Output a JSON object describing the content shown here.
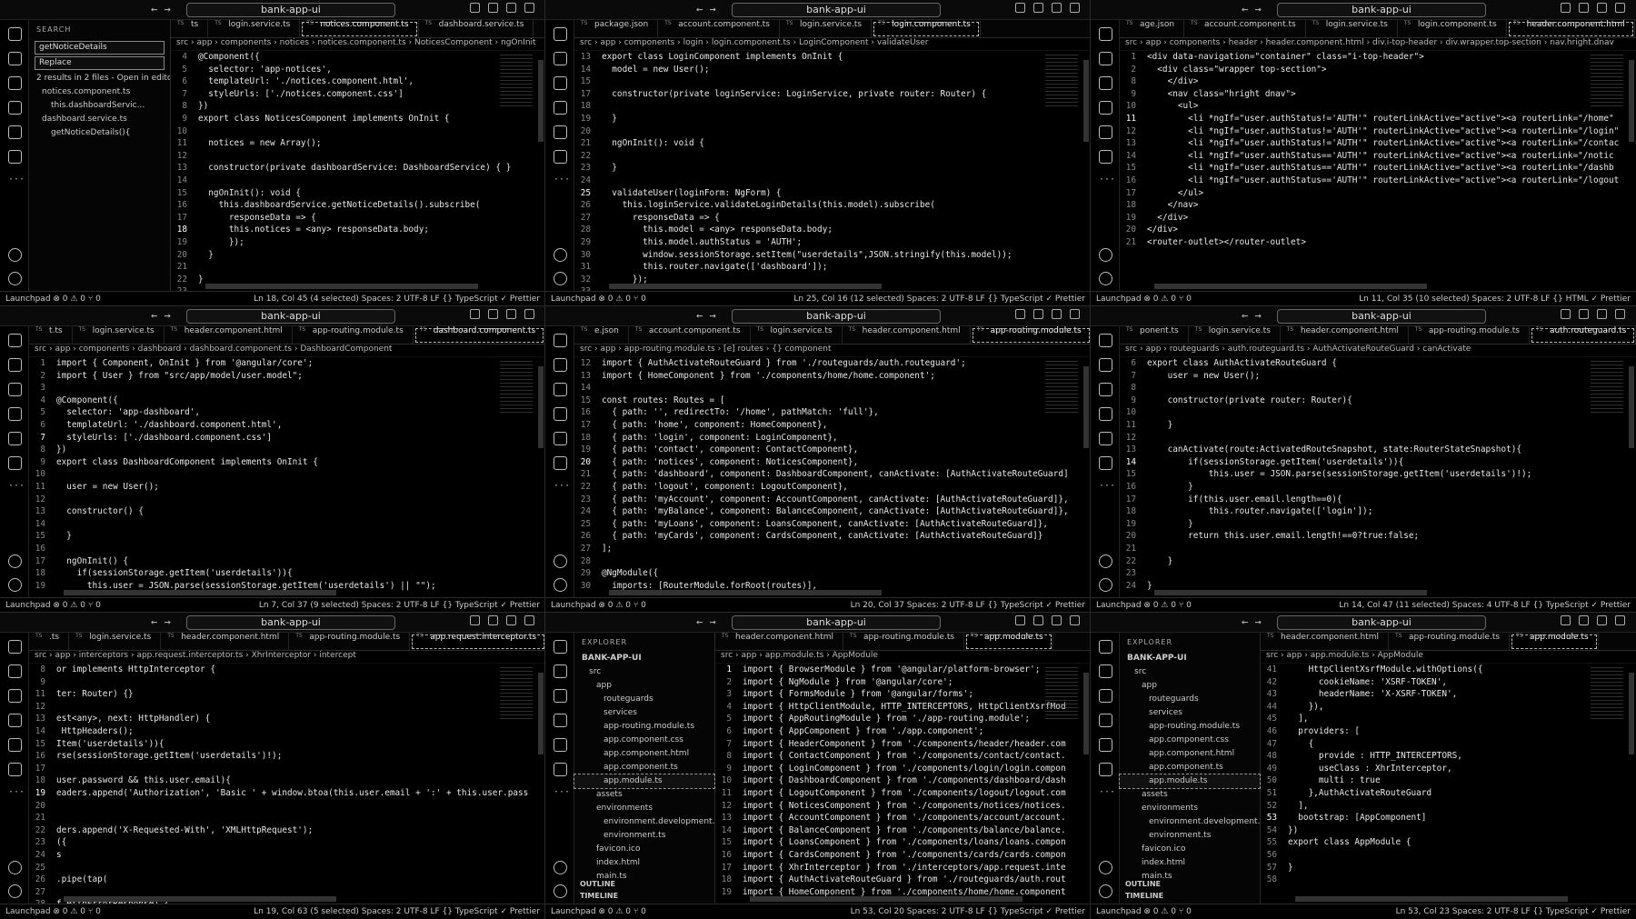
{
  "window_title": "bank-app-ui",
  "nav_arrows": "← →",
  "panes": [
    {
      "sidebar": {
        "type": "search",
        "header": "SEARCH",
        "search_value": "getNoticeDetails",
        "replace_placeholder": "Replace",
        "rows": [
          "2 results in 2 files - Open in editor",
          "notices.component.ts",
          "this.dashboardServic...",
          "dashboard.service.ts",
          "getNoticeDetails(){"
        ]
      },
      "tabs": [
        "ts",
        "login.service.ts",
        "notices.component.ts",
        "dashboard.service.ts"
      ],
      "active_tab": 2,
      "breadcrumb": "src › app › components › notices › notices.component.ts › NoticesComponent › ngOnInit",
      "lines": [
        [
          "4",
          "@Component({"
        ],
        [
          "5",
          "  selector: 'app-notices',"
        ],
        [
          "6",
          "  templateUrl: './notices.component.html',"
        ],
        [
          "7",
          "  styleUrls: ['./notices.component.css']"
        ],
        [
          "8",
          "})"
        ],
        [
          "9",
          "export class NoticesComponent implements OnInit {"
        ],
        [
          "10",
          ""
        ],
        [
          "11",
          "  notices = new Array();"
        ],
        [
          "12",
          ""
        ],
        [
          "13",
          "  constructor(private dashboardService: DashboardService) { }"
        ],
        [
          "14",
          ""
        ],
        [
          "15",
          "  ngOnInit(): void {"
        ],
        [
          "16",
          "    this.dashboardService.getNoticeDetails().subscribe("
        ],
        [
          "17",
          "      responseData => {"
        ],
        [
          "18",
          "      this.notices = <any> responseData.body;"
        ],
        [
          "19",
          "      });"
        ],
        [
          "20",
          "  }"
        ],
        [
          "21",
          ""
        ],
        [
          "22",
          "}"
        ],
        [
          "23",
          ""
        ]
      ],
      "current_line": "18",
      "status_left": "Launchpad  ⊗ 0 ⚠ 0  ⑂ 0",
      "status_right": "Ln 18, Col 45 (4 selected)   Spaces: 2   UTF-8   LF   {} TypeScript   ✓ Prettier"
    },
    {
      "tabs": [
        "package.json",
        "account.component.ts",
        "login.service.ts",
        "login.component.ts"
      ],
      "active_tab": 3,
      "breadcrumb": "src › app › components › login › login.component.ts › LoginComponent › validateUser",
      "lines": [
        [
          "13",
          "export class LoginComponent implements OnInit {"
        ],
        [
          "14",
          "  model = new User();"
        ],
        [
          "15",
          ""
        ],
        [
          "17",
          "  constructor(private loginService: LoginService, private router: Router) {"
        ],
        [
          "18",
          ""
        ],
        [
          "19",
          "  }"
        ],
        [
          "20",
          ""
        ],
        [
          "21",
          "  ngOnInit(): void {"
        ],
        [
          "22",
          ""
        ],
        [
          "23",
          "  }"
        ],
        [
          "24",
          ""
        ],
        [
          "25",
          "  validateUser(loginForm: NgForm) {"
        ],
        [
          "26",
          "    this.loginService.validateLoginDetails(this.model).subscribe("
        ],
        [
          "27",
          "      responseData => {"
        ],
        [
          "28",
          "        this.model = <any> responseData.body;"
        ],
        [
          "29",
          "        this.model.authStatus = 'AUTH';"
        ],
        [
          "30",
          "        window.sessionStorage.setItem(\"userdetails\",JSON.stringify(this.model));"
        ],
        [
          "31",
          "        this.router.navigate(['dashboard']);"
        ],
        [
          "32",
          "      });"
        ],
        [
          "33",
          ""
        ]
      ],
      "current_line": "25",
      "status_left": "Launchpad  ⊗ 0 ⚠ 0  ⑂ 0",
      "status_right": "Ln 25, Col 16 (12 selected)   Spaces: 2   UTF-8   LF   {} TypeScript   ✓ Prettier"
    },
    {
      "tabs": [
        "age.json",
        "account.component.ts",
        "login.service.ts",
        "login.component.ts",
        "header.component.html"
      ],
      "active_tab": 4,
      "breadcrumb": "src › app › components › header › header.component.html › div.i-top-header › div.wrapper.top-section › nav.hright.dnav",
      "lines": [
        [
          "1",
          "<div data-navigation=\"container\" class=\"i-top-header\">"
        ],
        [
          "2",
          "  <div class=\"wrapper top-section\">"
        ],
        [
          "8",
          "    </div>"
        ],
        [
          "9",
          "    <nav class=\"hright dnav\">"
        ],
        [
          "10",
          "      <ul>"
        ],
        [
          "11",
          "        <li *ngIf=\"user.authStatus!='AUTH'\" routerLinkActive=\"active\"><a routerLink=\"/home\""
        ],
        [
          "12",
          "        <li *ngIf=\"user.authStatus!='AUTH'\" routerLinkActive=\"active\"><a routerLink=\"/login\""
        ],
        [
          "13",
          "        <li *ngIf=\"user.authStatus!='AUTH'\" routerLinkActive=\"active\"><a routerLink=\"/contac"
        ],
        [
          "14",
          "        <li *ngIf=\"user.authStatus=='AUTH'\" routerLinkActive=\"active\"><a routerLink=\"/notic"
        ],
        [
          "15",
          "        <li *ngIf=\"user.authStatus=='AUTH'\" routerLinkActive=\"active\"><a routerLink=\"/dashb"
        ],
        [
          "16",
          "        <li *ngIf=\"user.authStatus=='AUTH'\" routerLinkActive=\"active\"><a routerLink=\"/logout"
        ],
        [
          "17",
          "      </ul>"
        ],
        [
          "18",
          "    </nav>"
        ],
        [
          "19",
          "  </div>"
        ],
        [
          "20",
          "</div>"
        ],
        [
          "21",
          "<router-outlet></router-outlet>"
        ]
      ],
      "current_line": "11",
      "status_left": "Launchpad  ⊗ 0 ⚠ 0  ⑂ 0",
      "status_right": "Ln 11, Col 35 (10 selected)   Spaces: 2   UTF-8   LF   {} HTML   ✓ Prettier"
    },
    {
      "tabs": [
        "t.ts",
        "login.service.ts",
        "header.component.html",
        "app-routing.module.ts",
        "dashboard.component.ts"
      ],
      "active_tab": 4,
      "breadcrumb": "src › app › components › dashboard › dashboard.component.ts › DashboardComponent",
      "lines": [
        [
          "1",
          "import { Component, OnInit } from '@angular/core';"
        ],
        [
          "2",
          "import { User } from \"src/app/model/user.model\";"
        ],
        [
          "3",
          ""
        ],
        [
          "4",
          "@Component({"
        ],
        [
          "5",
          "  selector: 'app-dashboard',"
        ],
        [
          "6",
          "  templateUrl: './dashboard.component.html',"
        ],
        [
          "7",
          "  styleUrls: ['./dashboard.component.css']"
        ],
        [
          "8",
          "})"
        ],
        [
          "9",
          "export class DashboardComponent implements OnInit {"
        ],
        [
          "10",
          ""
        ],
        [
          "11",
          "  user = new User();"
        ],
        [
          "12",
          ""
        ],
        [
          "13",
          "  constructor() {"
        ],
        [
          "14",
          ""
        ],
        [
          "15",
          "  }"
        ],
        [
          "16",
          ""
        ],
        [
          "17",
          "  ngOnInit() {"
        ],
        [
          "18",
          "    if(sessionStorage.getItem('userdetails')){"
        ],
        [
          "19",
          "      this.user = JSON.parse(sessionStorage.getItem('userdetails') || \"\");"
        ]
      ],
      "current_line": "7",
      "status_left": "Launchpad  ⊗ 0 ⚠ 0  ⑂ 0",
      "status_right": "Ln 7, Col 37 (9 selected)   Spaces: 2   UTF-8   LF   {} TypeScript   ✓ Prettier"
    },
    {
      "tabs": [
        "e.json",
        "account.component.ts",
        "login.service.ts",
        "header.component.html",
        "app-routing.module.ts"
      ],
      "active_tab": 4,
      "breadcrumb": "src › app › app-routing.module.ts › [e] routes › {} component",
      "lines": [
        [
          "12",
          "import { AuthActivateRouteGuard } from './routeguards/auth.routeguard';"
        ],
        [
          "13",
          "import { HomeComponent } from './components/home/home.component';"
        ],
        [
          "14",
          ""
        ],
        [
          "15",
          "const routes: Routes = ["
        ],
        [
          "16",
          "  { path: '', redirectTo: '/home', pathMatch: 'full'},"
        ],
        [
          "17",
          "  { path: 'home', component: HomeComponent},"
        ],
        [
          "18",
          "  { path: 'login', component: LoginComponent},"
        ],
        [
          "19",
          "  { path: 'contact', component: ContactComponent},"
        ],
        [
          "20",
          "  { path: 'notices', component: NoticesComponent},"
        ],
        [
          "21",
          "  { path: 'dashboard', component: DashboardComponent, canActivate: [AuthActivateRouteGuard]"
        ],
        [
          "22",
          "  { path: 'logout', component: LogoutComponent},"
        ],
        [
          "23",
          "  { path: 'myAccount', component: AccountComponent, canActivate: [AuthActivateRouteGuard]},"
        ],
        [
          "24",
          "  { path: 'myBalance', component: BalanceComponent, canActivate: [AuthActivateRouteGuard]},"
        ],
        [
          "25",
          "  { path: 'myLoans', component: LoansComponent, canActivate: [AuthActivateRouteGuard]},"
        ],
        [
          "26",
          "  { path: 'myCards', component: CardsComponent, canActivate: [AuthActivateRouteGuard]}"
        ],
        [
          "27",
          "];"
        ],
        [
          "28",
          ""
        ],
        [
          "29",
          "@NgModule({"
        ],
        [
          "30",
          "  imports: [RouterModule.forRoot(routes)],"
        ]
      ],
      "current_line": "20",
      "status_left": "Launchpad  ⊗ 0 ⚠ 0  ⑂ 0",
      "status_right": "Ln 20, Col 37   Spaces: 2   UTF-8   LF   {} TypeScript   ✓ Prettier"
    },
    {
      "tabs": [
        "ponent.ts",
        "login.service.ts",
        "header.component.html",
        "app-routing.module.ts",
        "auth.routeguard.ts"
      ],
      "active_tab": 4,
      "breadcrumb": "src › app › routeguards › auth.routeguard.ts › AuthActivateRouteGuard › canActivate",
      "lines": [
        [
          "6",
          "export class AuthActivateRouteGuard {"
        ],
        [
          "7",
          "    user = new User();"
        ],
        [
          "8",
          ""
        ],
        [
          "9",
          "    constructor(private router: Router){"
        ],
        [
          "10",
          ""
        ],
        [
          "11",
          "    }"
        ],
        [
          "12",
          ""
        ],
        [
          "13",
          "    canActivate(route:ActivatedRouteSnapshot, state:RouterStateSnapshot){"
        ],
        [
          "14",
          "        if(sessionStorage.getItem('userdetails')){"
        ],
        [
          "15",
          "            this.user = JSON.parse(sessionStorage.getItem('userdetails')!);"
        ],
        [
          "16",
          "        }"
        ],
        [
          "17",
          "        if(this.user.email.length==0){"
        ],
        [
          "18",
          "            this.router.navigate(['login']);"
        ],
        [
          "19",
          "        }"
        ],
        [
          "20",
          "        return this.user.email.length!==0?true:false;"
        ],
        [
          "21",
          ""
        ],
        [
          "22",
          "    }"
        ],
        [
          "23",
          ""
        ],
        [
          "24",
          "}"
        ]
      ],
      "current_line": "14",
      "status_left": "Launchpad  ⊗ 0 ⚠ 0  ⑂ 0",
      "status_right": "Ln 14, Col 47 (11 selected)   Spaces: 4   UTF-8   LF   {} TypeScript   ✓ Prettier"
    },
    {
      "tabs": [
        ".ts",
        "login.service.ts",
        "header.component.html",
        "app-routing.module.ts",
        "app.request.interceptor.ts"
      ],
      "active_tab": 4,
      "breadcrumb": "src › app › interceptors › app.request.interceptor.ts › XhrInterceptor › intercept",
      "lines": [
        [
          "8",
          "or implements HttpInterceptor {"
        ],
        [
          "9",
          ""
        ],
        [
          "11",
          "ter: Router) {}"
        ],
        [
          "12",
          ""
        ],
        [
          "13",
          "est<any>, next: HttpHandler) {"
        ],
        [
          "14",
          " HttpHeaders();"
        ],
        [
          "15",
          "Item('userdetails')){"
        ],
        [
          "16",
          "rse(sessionStorage.getItem('userdetails')!);"
        ],
        [
          "17",
          ""
        ],
        [
          "18",
          "user.password && this.user.email){"
        ],
        [
          "19",
          "eaders.append('Authorization', 'Basic ' + window.btoa(this.user.email + ':' + this.user.pass"
        ],
        [
          "20",
          ""
        ],
        [
          "21",
          ""
        ],
        [
          "22",
          "ders.append('X-Requested-With', 'XMLHttpRequest');"
        ],
        [
          "23",
          "({"
        ],
        [
          "24",
          "s"
        ],
        [
          "25",
          ""
        ],
        [
          "26",
          ".pipe(tap("
        ],
        [
          "27",
          ""
        ],
        [
          "28",
          "f HttpErrorResponse) {"
        ]
      ],
      "current_line": "19",
      "status_left": "Launchpad  ⊗ 0 ⚠ 0  ⑂ 0",
      "status_right": "Ln 19, Col 63 (5 selected)   Spaces: 2   UTF-8   LF   {} TypeScript   ✓ Prettier"
    },
    {
      "sidebar": {
        "type": "explorer",
        "header": "EXPLORER",
        "root": "BANK-APP-UI",
        "rows": [
          "src",
          "app",
          "routeguards",
          "services",
          "app-routing.module.ts",
          "app.component.css",
          "app.component.html",
          "app.component.ts",
          "app.module.ts",
          "assets",
          "environments",
          "environment.development.ts",
          "environment.ts",
          "favicon.ico",
          "index.html",
          "main.ts"
        ],
        "selected": 8,
        "footer": [
          "OUTLINE",
          "TIMELINE"
        ]
      },
      "tabs": [
        "header.component.html",
        "app-routing.module.ts",
        "app.module.ts"
      ],
      "active_tab": 2,
      "breadcrumb": "src › app › app.module.ts › AppModule",
      "lines": [
        [
          "1",
          "import { BrowserModule } from '@angular/platform-browser';"
        ],
        [
          "2",
          "import { NgModule } from '@angular/core';"
        ],
        [
          "3",
          "import { FormsModule } from '@angular/forms';"
        ],
        [
          "4",
          "import { HttpClientModule, HTTP_INTERCEPTORS, HttpClientXsrfMod"
        ],
        [
          "5",
          "import { AppRoutingModule } from './app-routing.module';"
        ],
        [
          "6",
          "import { AppComponent } from './app.component';"
        ],
        [
          "7",
          "import { HeaderComponent } from './components/header/header.com"
        ],
        [
          "8",
          "import { ContactComponent } from './components/contact/contact."
        ],
        [
          "9",
          "import { LoginComponent } from './components/login/login.compon"
        ],
        [
          "10",
          "import { DashboardComponent } from './components/dashboard/dash"
        ],
        [
          "11",
          "import { LogoutComponent } from './components/logout/logout.com"
        ],
        [
          "12",
          "import { NoticesComponent } from './components/notices/notices."
        ],
        [
          "13",
          "import { AccountComponent } from './components/account/account."
        ],
        [
          "14",
          "import { BalanceComponent } from './components/balance/balance."
        ],
        [
          "15",
          "import { LoansComponent } from './components/loans/loans.compon"
        ],
        [
          "16",
          "import { CardsComponent } from './components/cards/cards.compon"
        ],
        [
          "17",
          "import { XhrInterceptor } from './interceptors/app.request.inte"
        ],
        [
          "18",
          "import { AuthActivateRouteGuard } from './routeguards/auth.rout"
        ],
        [
          "19",
          "import { HomeComponent } from './components/home/home.component"
        ]
      ],
      "current_line": "1",
      "status_left": "Launchpad  ⊗ 0 ⚠ 0  ⑂ 0",
      "status_right": "Ln 53, Col 20   Spaces: 2   UTF-8   LF   {} TypeScript   ✓ Prettier"
    },
    {
      "sidebar": {
        "type": "explorer",
        "header": "EXPLORER",
        "root": "BANK-APP-UI",
        "rows": [
          "src",
          "app",
          "routeguards",
          "services",
          "app-routing.module.ts",
          "app.component.css",
          "app.component.html",
          "app.component.ts",
          "app.module.ts",
          "assets",
          "environments",
          "environment.development.ts",
          "environment.ts",
          "favicon.ico",
          "index.html",
          "main.ts"
        ],
        "selected": 8,
        "footer": [
          "OUTLINE",
          "TIMELINE"
        ]
      },
      "tabs": [
        "header.component.html",
        "app-routing.module.ts",
        "app.module.ts"
      ],
      "active_tab": 2,
      "breadcrumb": "src › app › app.module.ts › AppModule",
      "lines": [
        [
          "41",
          "    HttpClientXsrfModule.withOptions({"
        ],
        [
          "42",
          "      cookieName: 'XSRF-TOKEN',"
        ],
        [
          "43",
          "      headerName: 'X-XSRF-TOKEN',"
        ],
        [
          "44",
          "    }),"
        ],
        [
          "45",
          "  ],"
        ],
        [
          "46",
          "  providers: ["
        ],
        [
          "47",
          "    {"
        ],
        [
          "48",
          "      provide : HTTP_INTERCEPTORS,"
        ],
        [
          "49",
          "      useClass : XhrInterceptor,"
        ],
        [
          "50",
          "      multi : true"
        ],
        [
          "51",
          "    },AuthActivateRouteGuard"
        ],
        [
          "52",
          "  ],"
        ],
        [
          "53",
          "  bootstrap: [AppComponent]"
        ],
        [
          "54",
          "})"
        ],
        [
          "55",
          "export class AppModule {"
        ],
        [
          "56",
          ""
        ],
        [
          "57",
          "}"
        ],
        [
          "58",
          ""
        ]
      ],
      "current_line": "53",
      "status_left": "Launchpad  ⊗ 0 ⚠ 0  ⑂ 0",
      "status_right": "Ln 53, Col 23   Spaces: 2   UTF-8   LF   {} TypeScript   ✓ Prettier"
    }
  ]
}
